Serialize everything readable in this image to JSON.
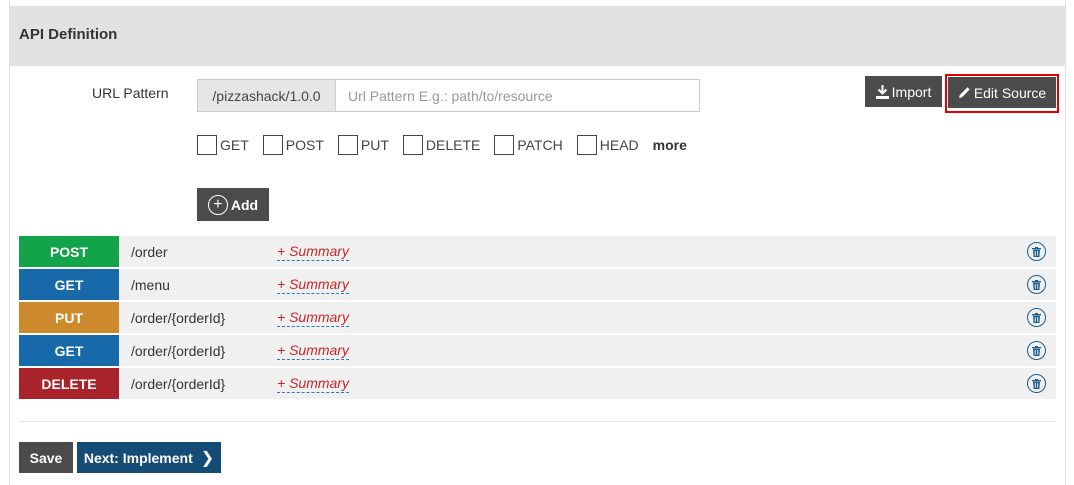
{
  "header": {
    "title": "API Definition"
  },
  "url": {
    "label": "URL Pattern",
    "prefix": "/pizzashack/1.0.0",
    "placeholder": "Url Pattern E.g.: path/to/resource",
    "value": ""
  },
  "toolbar": {
    "import_label": "Import",
    "edit_source_label": "Edit Source",
    "import_icon": "download-icon",
    "edit_icon": "pencil-icon"
  },
  "methods": {
    "items": [
      {
        "label": "GET",
        "checked": false
      },
      {
        "label": "POST",
        "checked": false
      },
      {
        "label": "PUT",
        "checked": false
      },
      {
        "label": "DELETE",
        "checked": false
      },
      {
        "label": "PATCH",
        "checked": false
      },
      {
        "label": "HEAD",
        "checked": false
      }
    ],
    "more_label": "more"
  },
  "add": {
    "label": "Add"
  },
  "resources": [
    {
      "method": "POST",
      "path": "/order",
      "summary": "+ Summary",
      "color": "#13a34a"
    },
    {
      "method": "GET",
      "path": "/menu",
      "summary": "+ Summary",
      "color": "#1769aa"
    },
    {
      "method": "PUT",
      "path": "/order/{orderId}",
      "summary": "+ Summary",
      "color": "#cc8a2c"
    },
    {
      "method": "GET",
      "path": "/order/{orderId}",
      "summary": "+ Summary",
      "color": "#1769aa"
    },
    {
      "method": "DELETE",
      "path": "/order/{orderId}",
      "summary": "+ Summary",
      "color": "#a8232a"
    }
  ],
  "footer": {
    "save_label": "Save",
    "next_label": "Next: Implement"
  },
  "colors": {
    "header_bg": "#e2e2e2",
    "dark_button": "#4b4b4b",
    "next_button": "#154c75",
    "highlight": "#e30000"
  }
}
